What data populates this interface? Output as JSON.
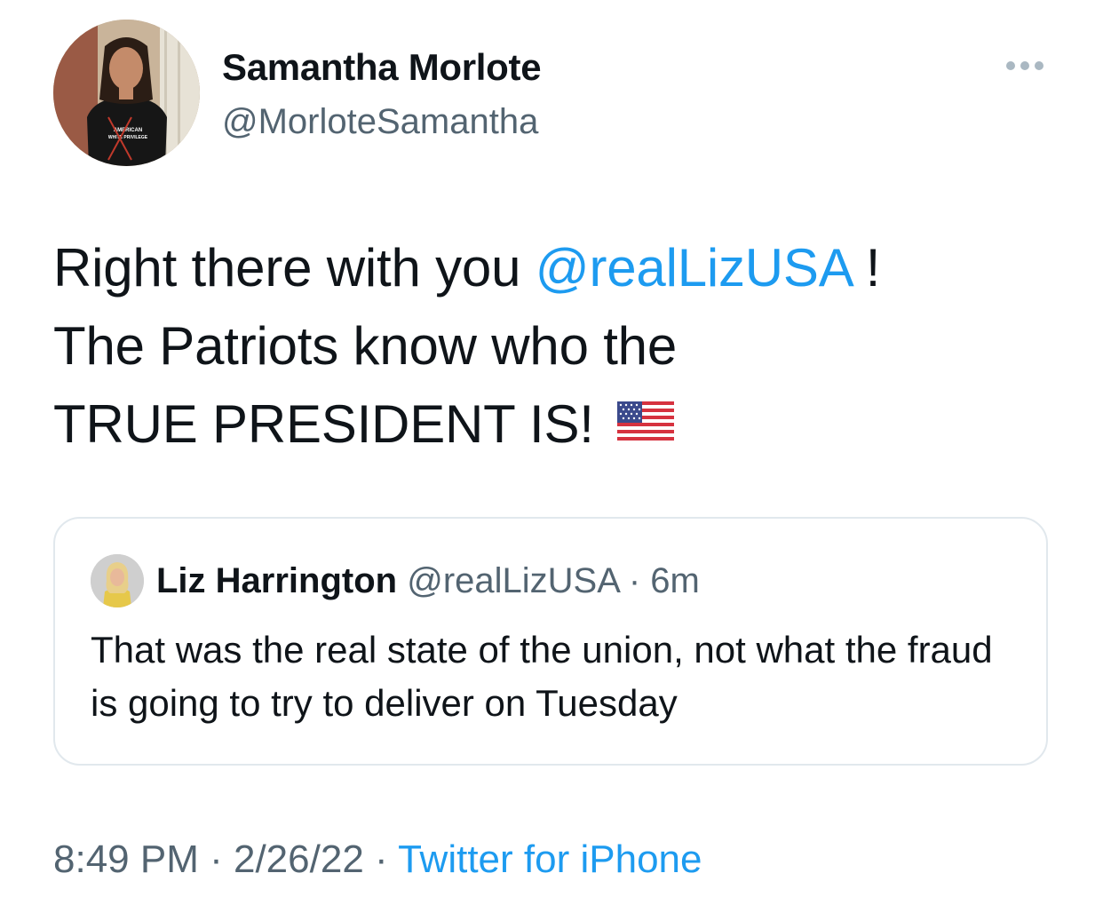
{
  "author": {
    "display_name": "Samantha Morlote",
    "handle": "@MorloteSamantha",
    "avatar_shirt_text_1": "AMERICAN",
    "avatar_shirt_text_2": "WHITE PRIVILEGE"
  },
  "tweet": {
    "line1_prefix": "Right there with you ",
    "mention": "@realLizUSA",
    "line1_suffix": " !",
    "line2": "The Patriots know who the",
    "line3": "TRUE PRESIDENT IS!",
    "emoji": "us-flag-icon"
  },
  "quoted_tweet": {
    "display_name": "Liz Harrington",
    "handle": "@realLizUSA",
    "separator": "·",
    "time": "6m",
    "text": "That was the real state of the union, not what the fraud is going to try to deliver on Tuesday"
  },
  "meta": {
    "time": "8:49 PM",
    "sep1": " · ",
    "date": "2/26/22",
    "sep2": " · ",
    "source": "Twitter for iPhone"
  },
  "colors": {
    "link": "#1d9bf0",
    "secondary": "#536471",
    "text": "#0f1419",
    "border": "#e1e8ed"
  }
}
